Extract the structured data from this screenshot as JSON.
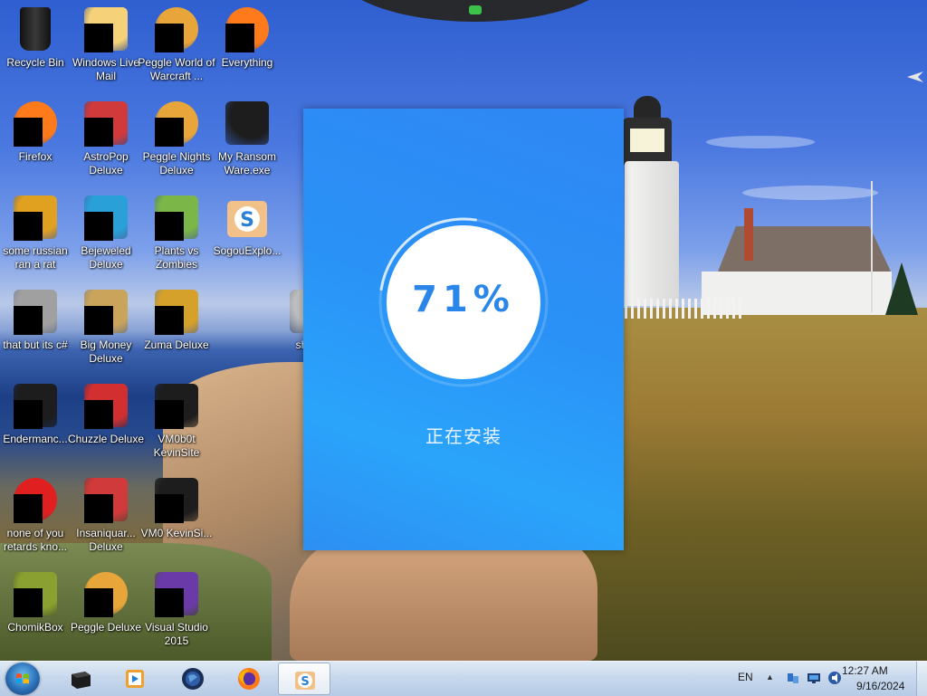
{
  "desktop": {
    "icons": [
      {
        "label": "Recycle Bin",
        "icon": "recycle-bin-icon",
        "redacted": false
      },
      {
        "label": "Windows Live Mail",
        "icon": "mail-icon",
        "redacted": true
      },
      {
        "label": "Peggle World of Warcraft ...",
        "icon": "peggle-icon",
        "redacted": true
      },
      {
        "label": "Everything",
        "icon": "search-magnifier-icon",
        "redacted": true
      },
      {
        "label": "Firefox",
        "icon": "firefox-icon",
        "redacted": true
      },
      {
        "label": "AstroPop Deluxe",
        "icon": "game-icon",
        "redacted": true
      },
      {
        "label": "Peggle Nights Deluxe",
        "icon": "peggle-icon",
        "redacted": true
      },
      {
        "label": "My Ransom Ware.exe",
        "icon": "executable-icon",
        "redacted": false
      },
      {
        "label": "some russian ran a rat",
        "icon": "folder-icon",
        "redacted": true
      },
      {
        "label": "Bejeweled Deluxe",
        "icon": "gem-icon",
        "redacted": true
      },
      {
        "label": "Plants vs Zombies",
        "icon": "plant-icon",
        "redacted": true
      },
      {
        "label": "SogouExplo...",
        "icon": "sogou-browser-icon",
        "redacted": false
      },
      {
        "label": "that but its c#",
        "icon": "stack-icon",
        "redacted": true
      },
      {
        "label": "Big Money Deluxe",
        "icon": "money-icon",
        "redacted": true
      },
      {
        "label": "Zuma Deluxe",
        "icon": "zuma-icon",
        "redacted": true
      },
      {
        "label": "sh ask",
        "icon": "file-icon",
        "redacted": false
      },
      {
        "label": "Endermanc...",
        "icon": "executable-icon",
        "redacted": true
      },
      {
        "label": "Chuzzle Deluxe",
        "icon": "chuzzle-icon",
        "redacted": true
      },
      {
        "label": "VM0b0t KevinSite",
        "icon": "executable-icon",
        "redacted": true
      },
      {
        "label": "none of you retards kno...",
        "icon": "opera-icon",
        "redacted": true
      },
      {
        "label": "Insaniquar... Deluxe",
        "icon": "game-icon",
        "redacted": true
      },
      {
        "label": "VM0 KevinSi...",
        "icon": "executable-icon",
        "redacted": true
      },
      {
        "label": "ChomikBox",
        "icon": "chomikbox-icon",
        "redacted": true
      },
      {
        "label": "Peggle Deluxe",
        "icon": "peggle-icon",
        "redacted": true
      },
      {
        "label": "Visual Studio 2015",
        "icon": "visual-studio-icon",
        "redacted": true
      }
    ]
  },
  "installer": {
    "progress_label": "71%",
    "progress_fraction": 0.71,
    "status": "正在安装",
    "background_color": "#2a92f6",
    "progress_text_color": "#2a86e9"
  },
  "taskbar": {
    "items": [
      {
        "name": "Start",
        "icon": "windows-start-icon"
      },
      {
        "name": "taskbar-app-1",
        "icon": "black-box-icon"
      },
      {
        "name": "taskbar-app-2",
        "icon": "media-player-icon"
      },
      {
        "name": "taskbar-app-3",
        "icon": "globe-icon"
      },
      {
        "name": "taskbar-app-4",
        "icon": "firefox-icon"
      },
      {
        "name": "taskbar-app-5",
        "icon": "sogou-browser-icon",
        "active": true
      }
    ],
    "tray": {
      "language": "EN",
      "time": "12:27 AM",
      "date": "9/16/2024"
    }
  }
}
